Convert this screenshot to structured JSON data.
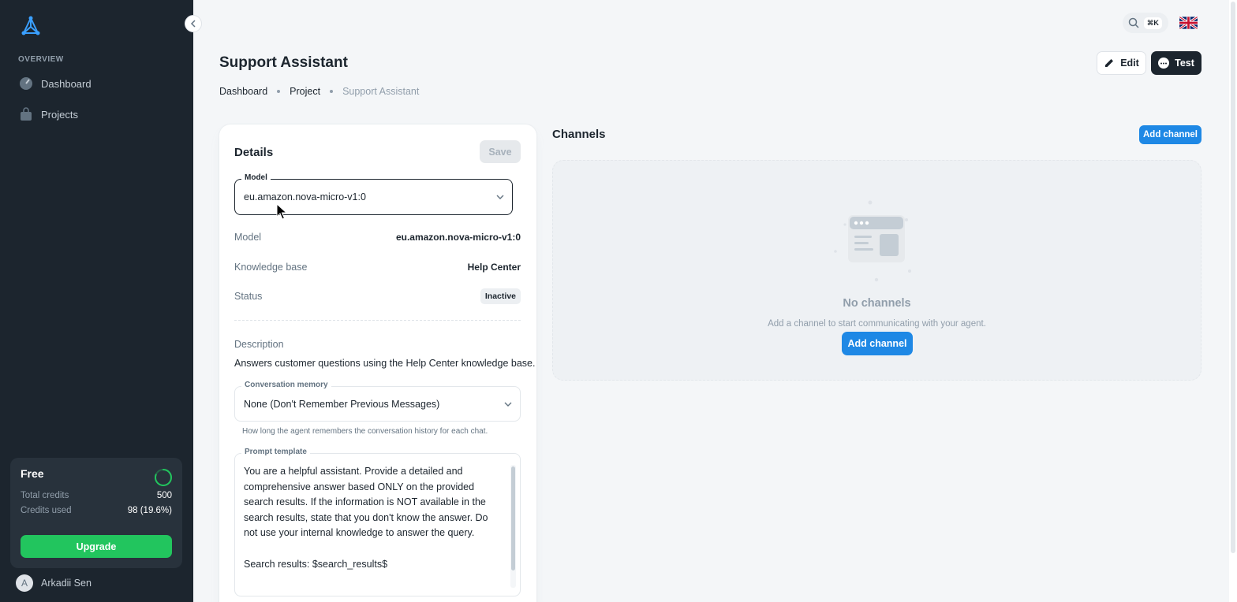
{
  "sidebar": {
    "section_header": "OVERVIEW",
    "items": [
      {
        "label": "Dashboard",
        "icon": "dashboard-icon"
      },
      {
        "label": "Projects",
        "icon": "bag-icon"
      }
    ],
    "plan": {
      "name": "Free",
      "total_credits_label": "Total credits",
      "total_credits_value": "500",
      "credits_used_label": "Credits used",
      "credits_used_value": "98 (19.6%)",
      "credits_used_fraction": 0.196,
      "upgrade_label": "Upgrade"
    },
    "user": {
      "initial": "A",
      "name": "Arkadii Sen"
    }
  },
  "topbar": {
    "shortcut": "⌘K",
    "language_flag": "uk-flag-icon"
  },
  "header": {
    "title": "Support Assistant",
    "breadcrumb": [
      "Dashboard",
      "Project",
      "Support Assistant"
    ],
    "edit_label": "Edit",
    "test_label": "Test"
  },
  "details": {
    "title": "Details",
    "save_label": "Save",
    "model_field_label": "Model",
    "model_value": "eu.amazon.nova-micro-v1:0",
    "rows": [
      {
        "label": "Model",
        "value": "eu.amazon.nova-micro-v1:0"
      },
      {
        "label": "Knowledge base",
        "value": "Help Center"
      },
      {
        "label": "Status",
        "value": "Inactive"
      }
    ],
    "description_label": "Description",
    "description_text": "Answers customer questions using the Help Center knowledge base.",
    "memory_field_label": "Conversation memory",
    "memory_value": "None (Don't Remember Previous Messages)",
    "memory_helper": "How long the agent remembers the conversation history for each chat.",
    "prompt_field_label": "Prompt template",
    "prompt_text": "You are a helpful assistant. Provide a detailed and comprehensive answer based ONLY on the provided search results. If the information is NOT available in the search results, state that you don't know the answer. Do not use your internal knowledge to answer the query.\n\nSearch results: $search_results$"
  },
  "channels": {
    "title": "Channels",
    "add_label": "Add channel",
    "empty_title": "No channels",
    "empty_subtitle": "Add a channel to start communicating with your agent.",
    "empty_add_label": "Add channel"
  },
  "colors": {
    "sidebar_bg": "#1c252e",
    "accent_blue": "#1e88e5",
    "upgrade_green": "#22c55e"
  }
}
